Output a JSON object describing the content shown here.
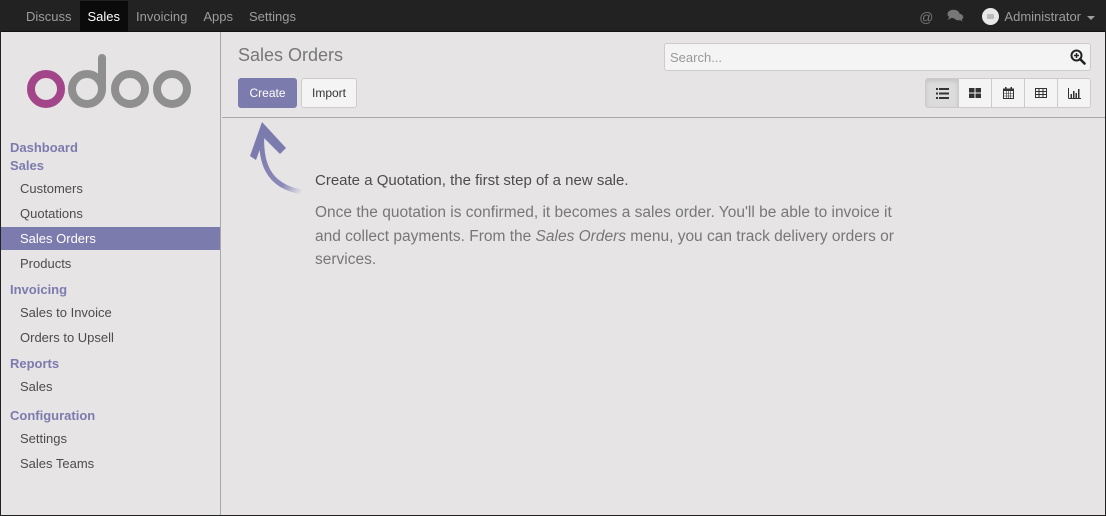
{
  "topbar": {
    "menu": [
      {
        "label": "Discuss",
        "active": false
      },
      {
        "label": "Sales",
        "active": true
      },
      {
        "label": "Invoicing",
        "active": false
      },
      {
        "label": "Apps",
        "active": false
      },
      {
        "label": "Settings",
        "active": false
      }
    ],
    "icons": [
      "at-icon",
      "chat-icon"
    ],
    "user": "Administrator"
  },
  "logo": {
    "text": "odoo",
    "colors": {
      "first": "#a24689",
      "rest": "#8f8f8f"
    }
  },
  "sidebar": {
    "dashboard": "Dashboard",
    "sections": [
      {
        "label": "Sales",
        "items": [
          "Customers",
          "Quotations",
          "Sales Orders",
          "Products"
        ]
      },
      {
        "label": "Invoicing",
        "items": [
          "Sales to Invoice",
          "Orders to Upsell"
        ]
      },
      {
        "label": "Reports",
        "items": [
          "Sales"
        ]
      },
      {
        "label": "Configuration",
        "items": [
          "Settings",
          "Sales Teams"
        ]
      }
    ],
    "active_item": "Sales Orders"
  },
  "control_panel": {
    "title": "Sales Orders",
    "create_label": "Create",
    "import_label": "Import",
    "search_placeholder": "Search...",
    "views": [
      "list-view",
      "kanban-view",
      "calendar-view",
      "pivot-view",
      "graph-view"
    ],
    "active_view": "list-view"
  },
  "help": {
    "title": "Create a Quotation, the first step of a new sale.",
    "text_before": "Once the quotation is confirmed, it becomes a sales order. You'll be able to invoice it and collect payments. From the ",
    "text_em": "Sales Orders",
    "text_after": " menu, you can track delivery orders or services."
  },
  "colors": {
    "accent": "#7c7bad",
    "topbar": "#222222",
    "background": "#e6e4e5"
  }
}
